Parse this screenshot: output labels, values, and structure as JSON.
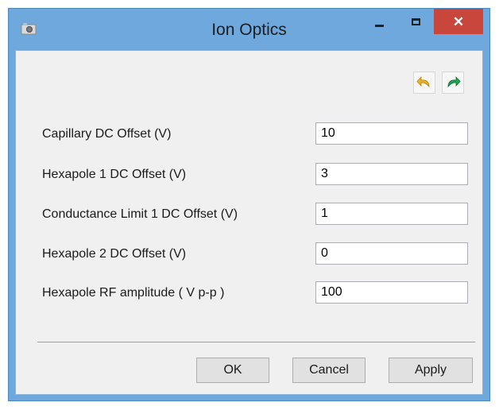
{
  "window": {
    "title": "Ion Optics"
  },
  "fields": [
    {
      "label": "Capillary DC Offset (V)",
      "value": "10"
    },
    {
      "label": "Hexapole 1 DC Offset (V)",
      "value": "3"
    },
    {
      "label": "Conductance Limit 1 DC Offset (V)",
      "value": "1"
    },
    {
      "label": "Hexapole 2 DC Offset (V)",
      "value": "0"
    },
    {
      "label": "Hexapole RF amplitude ( V p-p )",
      "value": "100"
    }
  ],
  "buttons": {
    "ok": "OK",
    "cancel": "Cancel",
    "apply": "Apply"
  },
  "icons": {
    "undo": "undo-arrow-icon",
    "redo": "redo-arrow-icon"
  },
  "colors": {
    "undo": "#f2b51c",
    "redo": "#1aa84e",
    "close": "#c9463d",
    "frame": "#6fa8dc"
  }
}
